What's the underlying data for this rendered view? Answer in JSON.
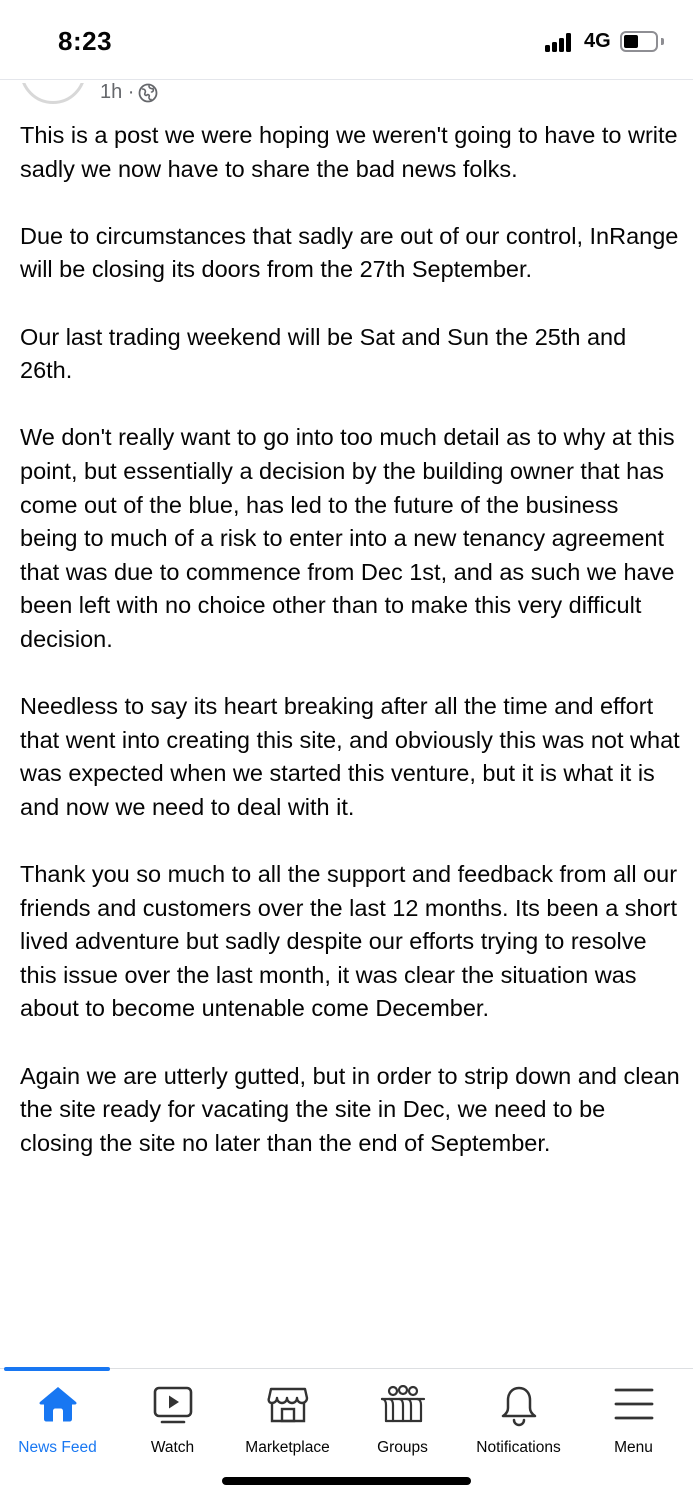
{
  "status_bar": {
    "time": "8:23",
    "network": "4G"
  },
  "post": {
    "timestamp": "1h ·",
    "paragraphs": [
      "This is a post we were hoping we weren't going to have to write sadly we now have to share the bad news folks.",
      "Due to circumstances that sadly are out of our control, InRange will be closing its doors from the 27th September.",
      "Our last trading weekend will be Sat and Sun the 25th and 26th.",
      "We don't really want to go into too much detail as to why at this point, but essentially a decision by the building owner that has come out of the blue, has led to the future of the business being to much of a risk to enter into a new tenancy agreement that was due to commence from Dec 1st, and as such we have been left with no choice other than to make this very difficult decision.",
      "Needless to say its heart breaking after all the time and effort that went into creating this site, and obviously this was not what was expected when we started this venture, but it is what it is and now we need to deal with it.",
      "Thank you so much to all the support and feedback from all our friends and customers over the last 12 months. Its been a short lived adventure but sadly despite our efforts trying to resolve this issue over the last month, it was clear the situation was about to become untenable come December.",
      "Again we are utterly gutted, but in order to strip down and clean the site ready for vacating the site in Dec, we need to be closing the site no later than the end of September."
    ]
  },
  "tabs": [
    {
      "label": "News Feed",
      "icon": "home-icon",
      "active": true
    },
    {
      "label": "Watch",
      "icon": "watch-icon",
      "active": false
    },
    {
      "label": "Marketplace",
      "icon": "marketplace-icon",
      "active": false
    },
    {
      "label": "Groups",
      "icon": "groups-icon",
      "active": false
    },
    {
      "label": "Notifications",
      "icon": "bell-icon",
      "active": false
    },
    {
      "label": "Menu",
      "icon": "menu-icon",
      "active": false
    }
  ],
  "colors": {
    "accent": "#1877f2",
    "text": "#050505",
    "secondary_text": "#65676b"
  }
}
